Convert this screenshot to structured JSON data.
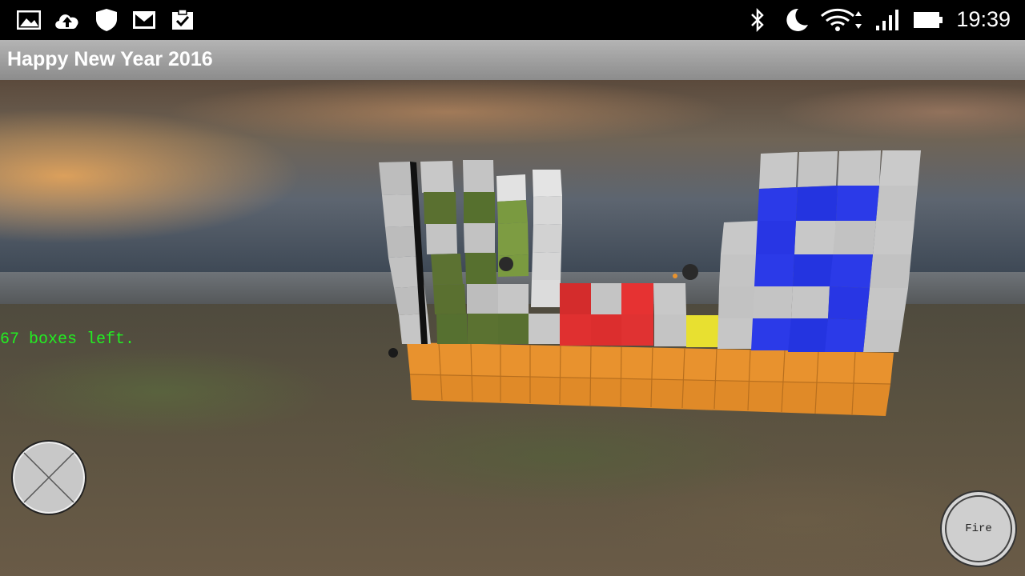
{
  "status_bar": {
    "left_icons": [
      "image-icon",
      "cloud-upload-icon",
      "shield-icon",
      "mail-icon",
      "clipboard-check-icon"
    ],
    "right_icons": [
      "bluetooth-icon",
      "moon-icon",
      "wifi-icon",
      "signal-icon",
      "battery-icon"
    ],
    "time": "19:39"
  },
  "app": {
    "title": "Happy New Year 2016"
  },
  "hud": {
    "status_text": "67 boxes left.",
    "status_color": "#22ee22",
    "fire_label": "Fire"
  },
  "colors": {
    "box_gray": "#c8c8c8",
    "box_green": "#5a7030",
    "box_light_green": "#7a9a40",
    "box_red": "#e03030",
    "box_yellow": "#e8e030",
    "box_blue": "#2b3ae8",
    "box_orange": "#e8922e"
  }
}
